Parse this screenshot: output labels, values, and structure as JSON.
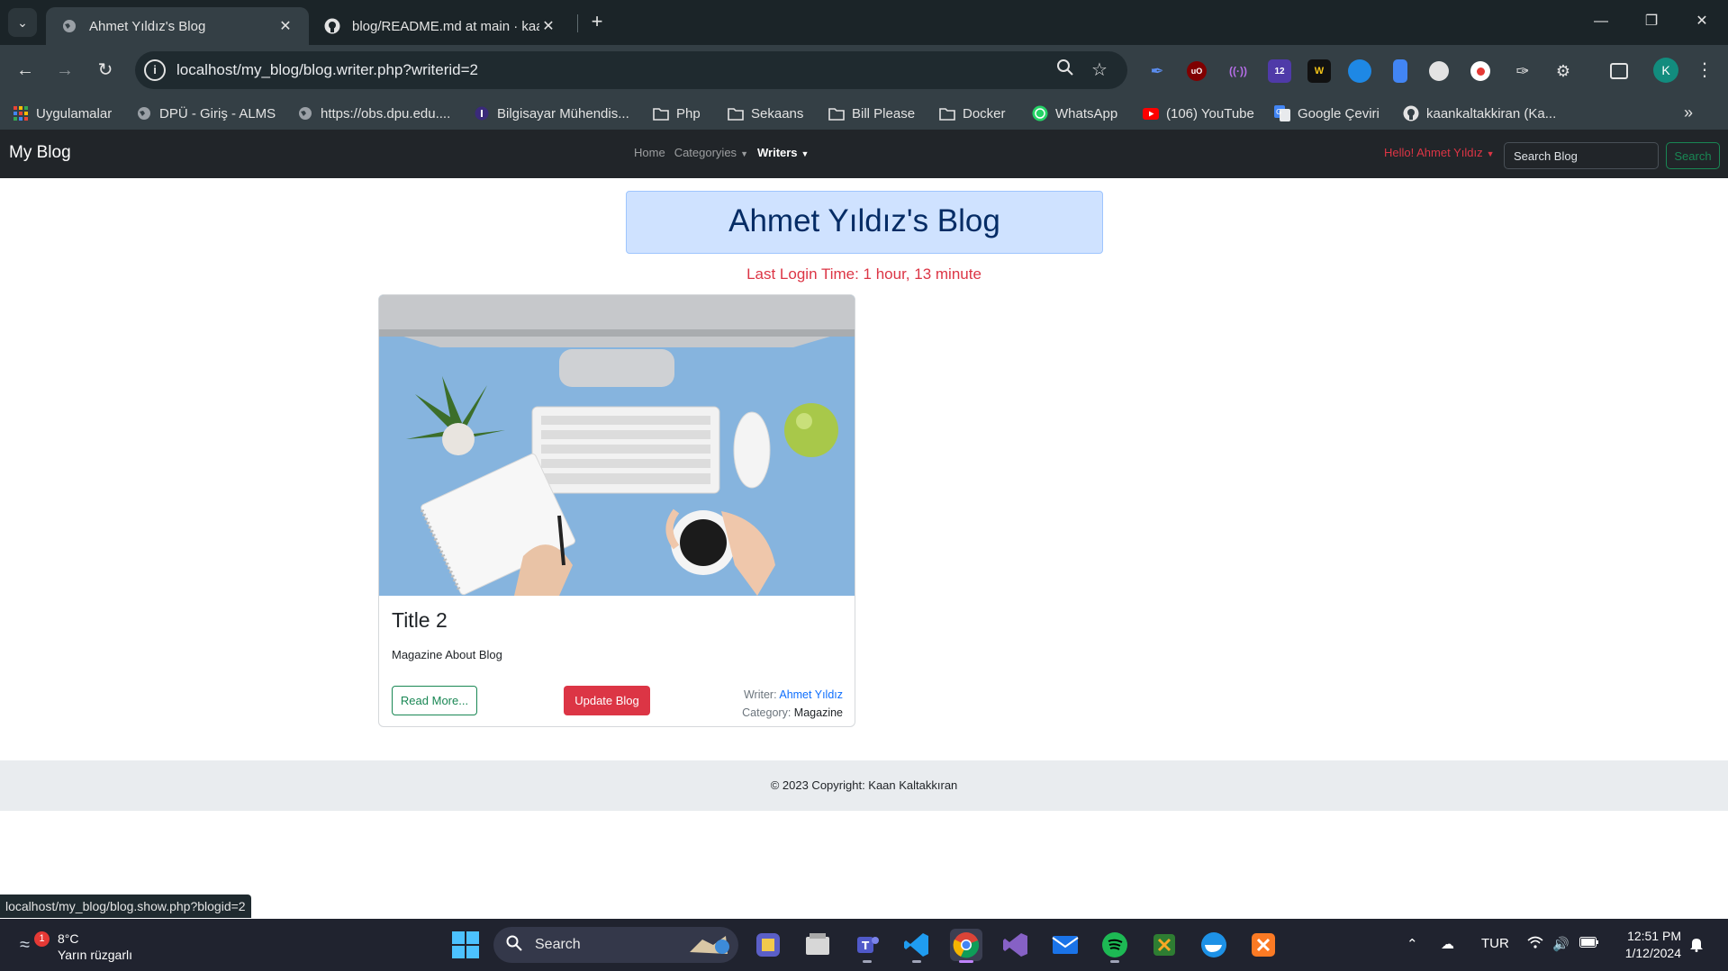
{
  "browser": {
    "tabs": [
      {
        "title": "Ahmet Yıldız's Blog",
        "active": true
      },
      {
        "title": "blog/README.md at main · kaankaltakkiran/blog",
        "active": false
      }
    ],
    "address": "localhost/my_blog/blog.writer.php?writerid=2",
    "profile_initial": "K",
    "extensions": [
      {
        "name": "brush-extension-icon",
        "label": "",
        "color": "#5b8def"
      },
      {
        "name": "ublock-icon",
        "label": "uO",
        "color": "#800000"
      },
      {
        "name": "wave-extension-icon",
        "label": "((·))",
        "color": "#6b2a8f"
      },
      {
        "name": "hat-extension-icon",
        "label": "12",
        "color": "#4f3aa8"
      },
      {
        "name": "wm-extension-icon",
        "label": "W",
        "color": "#111111"
      },
      {
        "name": "edge-extension-icon",
        "label": "",
        "color": "#1e88e5"
      },
      {
        "name": "doc-extension-icon",
        "label": "",
        "color": "#4285f4"
      },
      {
        "name": "ball-extension-icon",
        "label": "",
        "color": "#e3e3e3"
      },
      {
        "name": "record-extension-icon",
        "label": "",
        "color": "#ffffff"
      },
      {
        "name": "eyedropper-extension-icon",
        "label": "",
        "color": "#e3e3e3"
      }
    ],
    "bookmarks": [
      {
        "label": "Uygulamalar",
        "icon": "apps-grid-icon"
      },
      {
        "label": "DPÜ - Giriş - ALMS",
        "icon": "globe-icon"
      },
      {
        "label": "https://obs.dpu.edu....",
        "icon": "globe-icon"
      },
      {
        "label": "Bilgisayar Mühendis...",
        "icon": "university-icon"
      },
      {
        "label": "Php",
        "icon": "folder-icon"
      },
      {
        "label": "Sekaans",
        "icon": "folder-icon"
      },
      {
        "label": "Bill Please",
        "icon": "folder-icon"
      },
      {
        "label": "Docker",
        "icon": "folder-icon"
      },
      {
        "label": "WhatsApp",
        "icon": "whatsapp-icon"
      },
      {
        "label": "(106) YouTube",
        "icon": "youtube-icon"
      },
      {
        "label": "Google Çeviri",
        "icon": "google-translate-icon"
      },
      {
        "label": "kaankaltakkiran (Ka...",
        "icon": "github-icon"
      }
    ]
  },
  "site": {
    "brand": "My Blog",
    "nav": {
      "home": "Home",
      "categories": "Categoryies",
      "writers": "Writers"
    },
    "hello": "Hello! Ahmet Yıldız",
    "search_placeholder": "Search Blog",
    "search_button": "Search"
  },
  "main": {
    "blog_title": "Ahmet Yıldız's Blog",
    "last_login": "Last Login Time: 1 hour, 13 minute",
    "card": {
      "title": "Title 2",
      "text": "Magazine About Blog",
      "read_more": "Read More...",
      "update": "Update Blog",
      "writer_label": "Writer:",
      "writer_name": "Ahmet Yıldız",
      "category_label": "Category:",
      "category_value": "Magazine"
    }
  },
  "footer": {
    "copyright": "© 2023 Copyright: Kaan Kaltakkıran"
  },
  "status_bar_url": "localhost/my_blog/blog.show.php?blogid=2",
  "taskbar": {
    "weather_temp": "8°C",
    "weather_desc": "Yarın rüzgarlı",
    "weather_badge": "1",
    "search_label": "Search",
    "language": "TUR",
    "time": "12:51 PM",
    "date": "1/12/2024"
  },
  "colors": {
    "navbar_bg": "#212529",
    "accent_red": "#dc3545",
    "accent_green": "#198754",
    "title_box_bg": "#cfe2ff"
  }
}
